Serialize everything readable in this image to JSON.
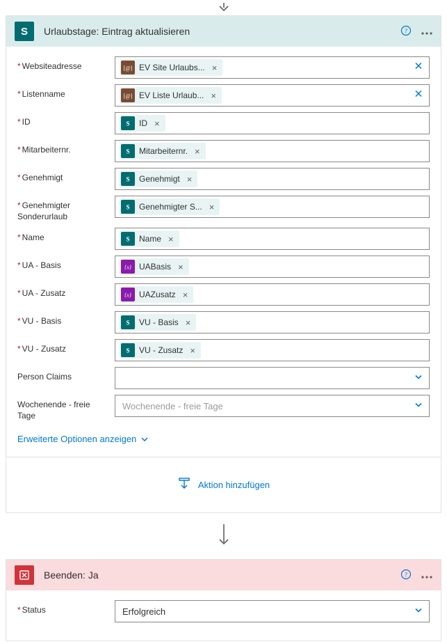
{
  "arrow": {
    "present": true
  },
  "card1": {
    "title": "Urlaubstage: Eintrag aktualisieren",
    "advancedToggle": "Erweiterte Optionen anzeigen",
    "fields": [
      {
        "label": "Websiteadresse",
        "required": true,
        "token": {
          "type": "env",
          "text": "EV Site Urlaubs..."
        },
        "clearable": true
      },
      {
        "label": "Listenname",
        "required": true,
        "token": {
          "type": "env",
          "text": "EV Liste Urlaub..."
        },
        "clearable": true
      },
      {
        "label": "ID",
        "required": true,
        "token": {
          "type": "sp",
          "text": "ID"
        }
      },
      {
        "label": "Mitarbeiternr.",
        "required": true,
        "token": {
          "type": "sp",
          "text": "Mitarbeiternr."
        }
      },
      {
        "label": "Genehmigt",
        "required": true,
        "token": {
          "type": "sp",
          "text": "Genehmigt"
        }
      },
      {
        "label": "Genehmigter Sonderurlaub",
        "required": true,
        "token": {
          "type": "sp",
          "text": "Genehmigter S..."
        }
      },
      {
        "label": "Name",
        "required": true,
        "token": {
          "type": "sp",
          "text": "Name"
        }
      },
      {
        "label": "UA - Basis",
        "required": true,
        "token": {
          "type": "var",
          "text": "UABasis"
        }
      },
      {
        "label": "UA - Zusatz",
        "required": true,
        "token": {
          "type": "var",
          "text": "UAZusatz"
        }
      },
      {
        "label": "VU - Basis",
        "required": true,
        "token": {
          "type": "sp",
          "text": "VU - Basis"
        }
      },
      {
        "label": "VU - Zusatz",
        "required": true,
        "token": {
          "type": "sp",
          "text": "VU - Zusatz"
        }
      },
      {
        "label": "Person Claims",
        "required": false,
        "dropdown": true,
        "placeholder": ""
      },
      {
        "label": "Wochenende - freie Tage",
        "required": false,
        "dropdown": true,
        "placeholder": "Wochenende - freie Tage"
      }
    ]
  },
  "addAction": {
    "label": "Aktion hinzufügen"
  },
  "card2": {
    "title": "Beenden: Ja",
    "statusLabel": "Status",
    "statusValue": "Erfolgreich"
  }
}
